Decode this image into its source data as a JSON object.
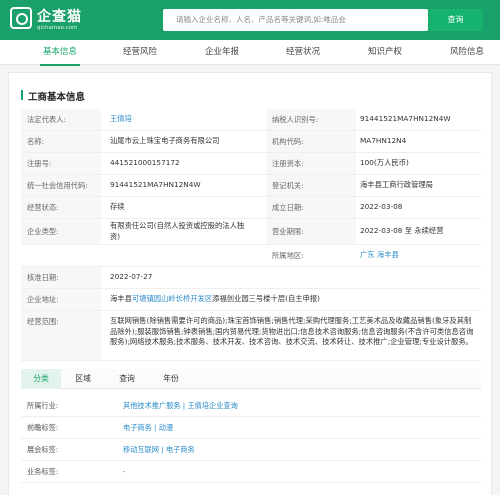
{
  "header": {
    "logo_text": "企查猫",
    "logo_sub": "qichamao.com",
    "search_placeholder": "请输入企业名称、人名、产品名等关键词,如:唯品会",
    "search_button": "查询"
  },
  "nav": [
    "基本信息",
    "经营风险",
    "企业年报",
    "经营状况",
    "知识产权",
    "风险信息"
  ],
  "section_title": "工商基本信息",
  "fields": {
    "legal_rep_label": "法定代表人:",
    "legal_rep_value": "王倩培",
    "taxpayer_id_label": "纳税人识别号:",
    "taxpayer_id_value": "91441521MA7HN12N4W",
    "name_label": "名称:",
    "name_value": "汕尾市云上珠宝电子商务有限公司",
    "org_code_label": "机构代码:",
    "org_code_value": "MA7HN12N4",
    "reg_no_label": "注册号:",
    "reg_no_value": "441521000157172",
    "reg_capital_label": "注册资本:",
    "reg_capital_value": "100(万人民币)",
    "credit_code_label": "统一社会信用代码:",
    "credit_code_value": "91441521MA7HN12N4W",
    "reg_authority_label": "登记机关:",
    "reg_authority_value": "海丰县工商行政管理局",
    "status_label": "经营状态:",
    "status_value": "存续",
    "founded_label": "成立日期:",
    "founded_value": "2022-03-08",
    "type_label": "企业类型:",
    "type_value": "有限责任公司(自然人投资或控股的法人独资)",
    "term_label": "营业期限:",
    "term_value": "2022-03-08 至 永续经营",
    "region_label": "所属地区:",
    "region_value": "广东 海丰县",
    "approval_label": "核准日期:",
    "approval_value": "2022-07-27",
    "address_label": "企业地址:",
    "address_prefix": "海丰县",
    "address_link": "可塘镇园山岭长桥开发区",
    "address_suffix": "添福创业园三号楼十层(自主申报)",
    "scope_label": "经营范围:",
    "scope_value": "互联网销售(除销售需要许可的商品);珠宝首饰销售;销售代理;采购代理服务;工艺美术品及收藏品销售(象牙及其制品除外);服装服饰销售;钟表销售;国内贸易代理;货物进出口;信息技术咨询服务;信息咨询服务(不含许可类信息咨询服务);网络技术服务;技术服务、技术开发、技术咨询、技术交流、技术转让、技术推广;企业管理;专业设计服务。"
  },
  "tabs": [
    "分类",
    "区域",
    "查询",
    "年份"
  ],
  "tags": [
    {
      "label": "所属行业:",
      "value": "其他技术推广服务 | 王倩培企业查询"
    },
    {
      "label": "前瞻标签:",
      "value": "电子商务 | 动漫"
    },
    {
      "label": "展会标签:",
      "value": "移动互联网 | 电子商务"
    },
    {
      "label": "业务标签:",
      "value": "-"
    }
  ]
}
